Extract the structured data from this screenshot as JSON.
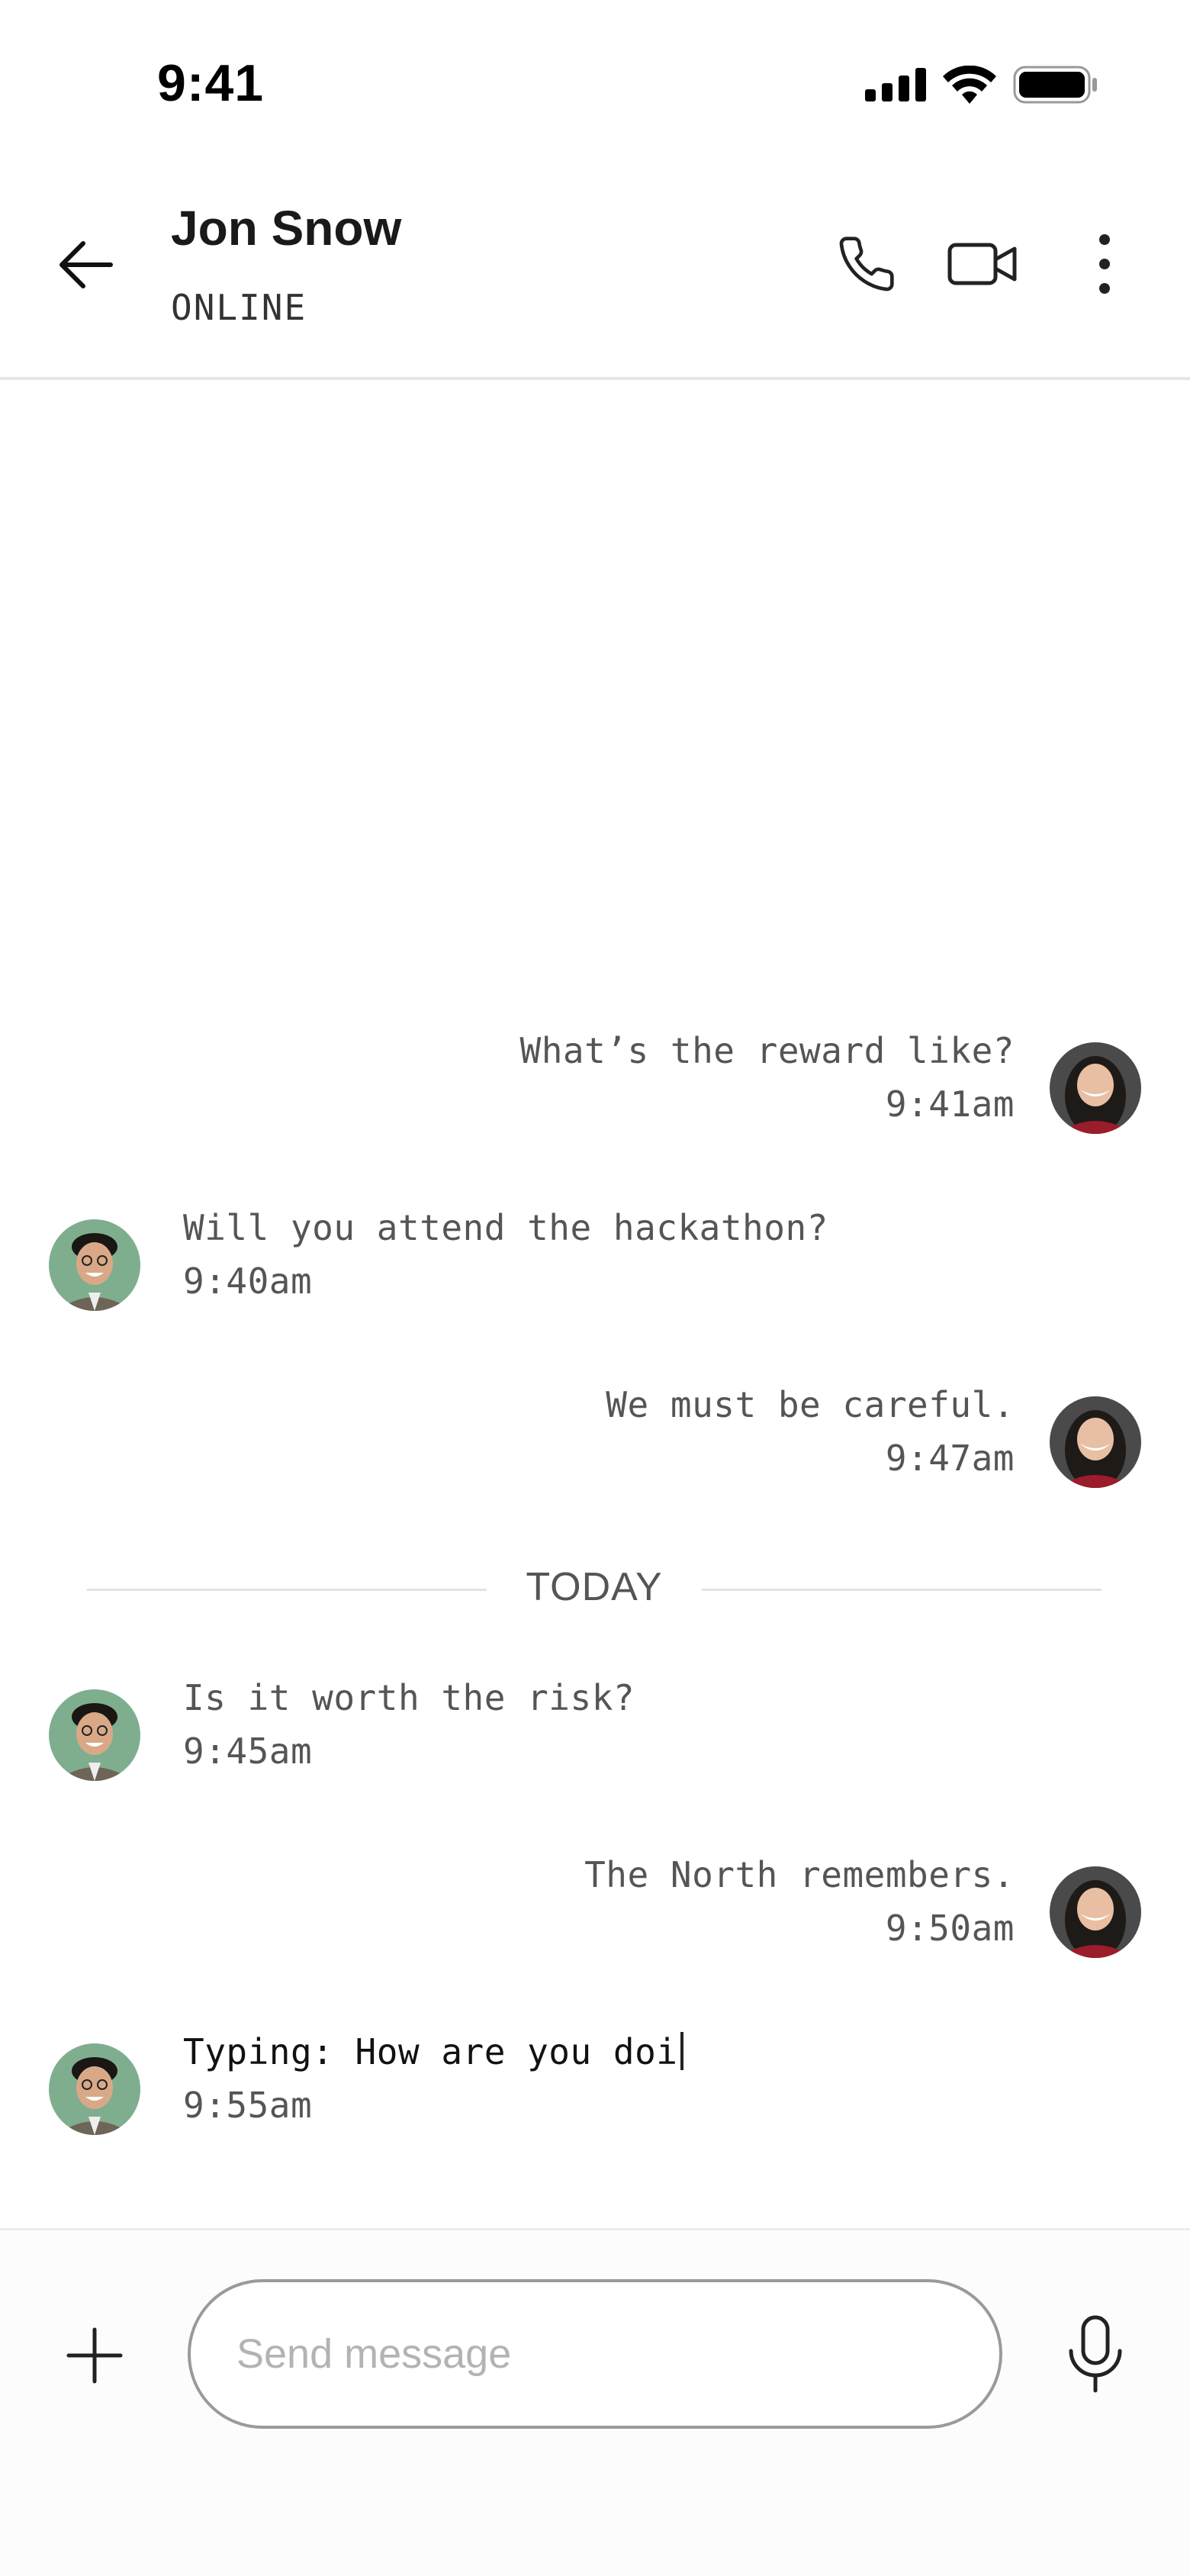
{
  "status_bar": {
    "time": "9:41"
  },
  "header": {
    "contact_name": "Jon Snow",
    "contact_status": "ONLINE",
    "icons": {
      "back": "arrow-left-icon",
      "call": "phone-icon",
      "video": "video-camera-icon",
      "more": "more-vertical-icon"
    }
  },
  "messages": [
    {
      "side": "right",
      "text": "What’s the reward like?",
      "time": "9:41am"
    },
    {
      "side": "left",
      "text": "Will you attend the hackathon?",
      "time": "9:40am"
    },
    {
      "side": "right",
      "text": "We must be careful.",
      "time": "9:47am"
    },
    {
      "side": "left",
      "text": "Is it worth the risk?",
      "time": "9:45am"
    },
    {
      "side": "right",
      "text": "The North remembers.",
      "time": "9:50am"
    },
    {
      "side": "left",
      "text": "Typing: How are you doi",
      "time": "9:55am"
    }
  ],
  "divider_label": "TODAY",
  "composer": {
    "placeholder": "Send message",
    "icons": {
      "add": "plus-icon",
      "mic": "microphone-icon"
    }
  },
  "colors": {
    "text": "#555555",
    "border": "#e6e6e6",
    "accent": "#000000"
  }
}
